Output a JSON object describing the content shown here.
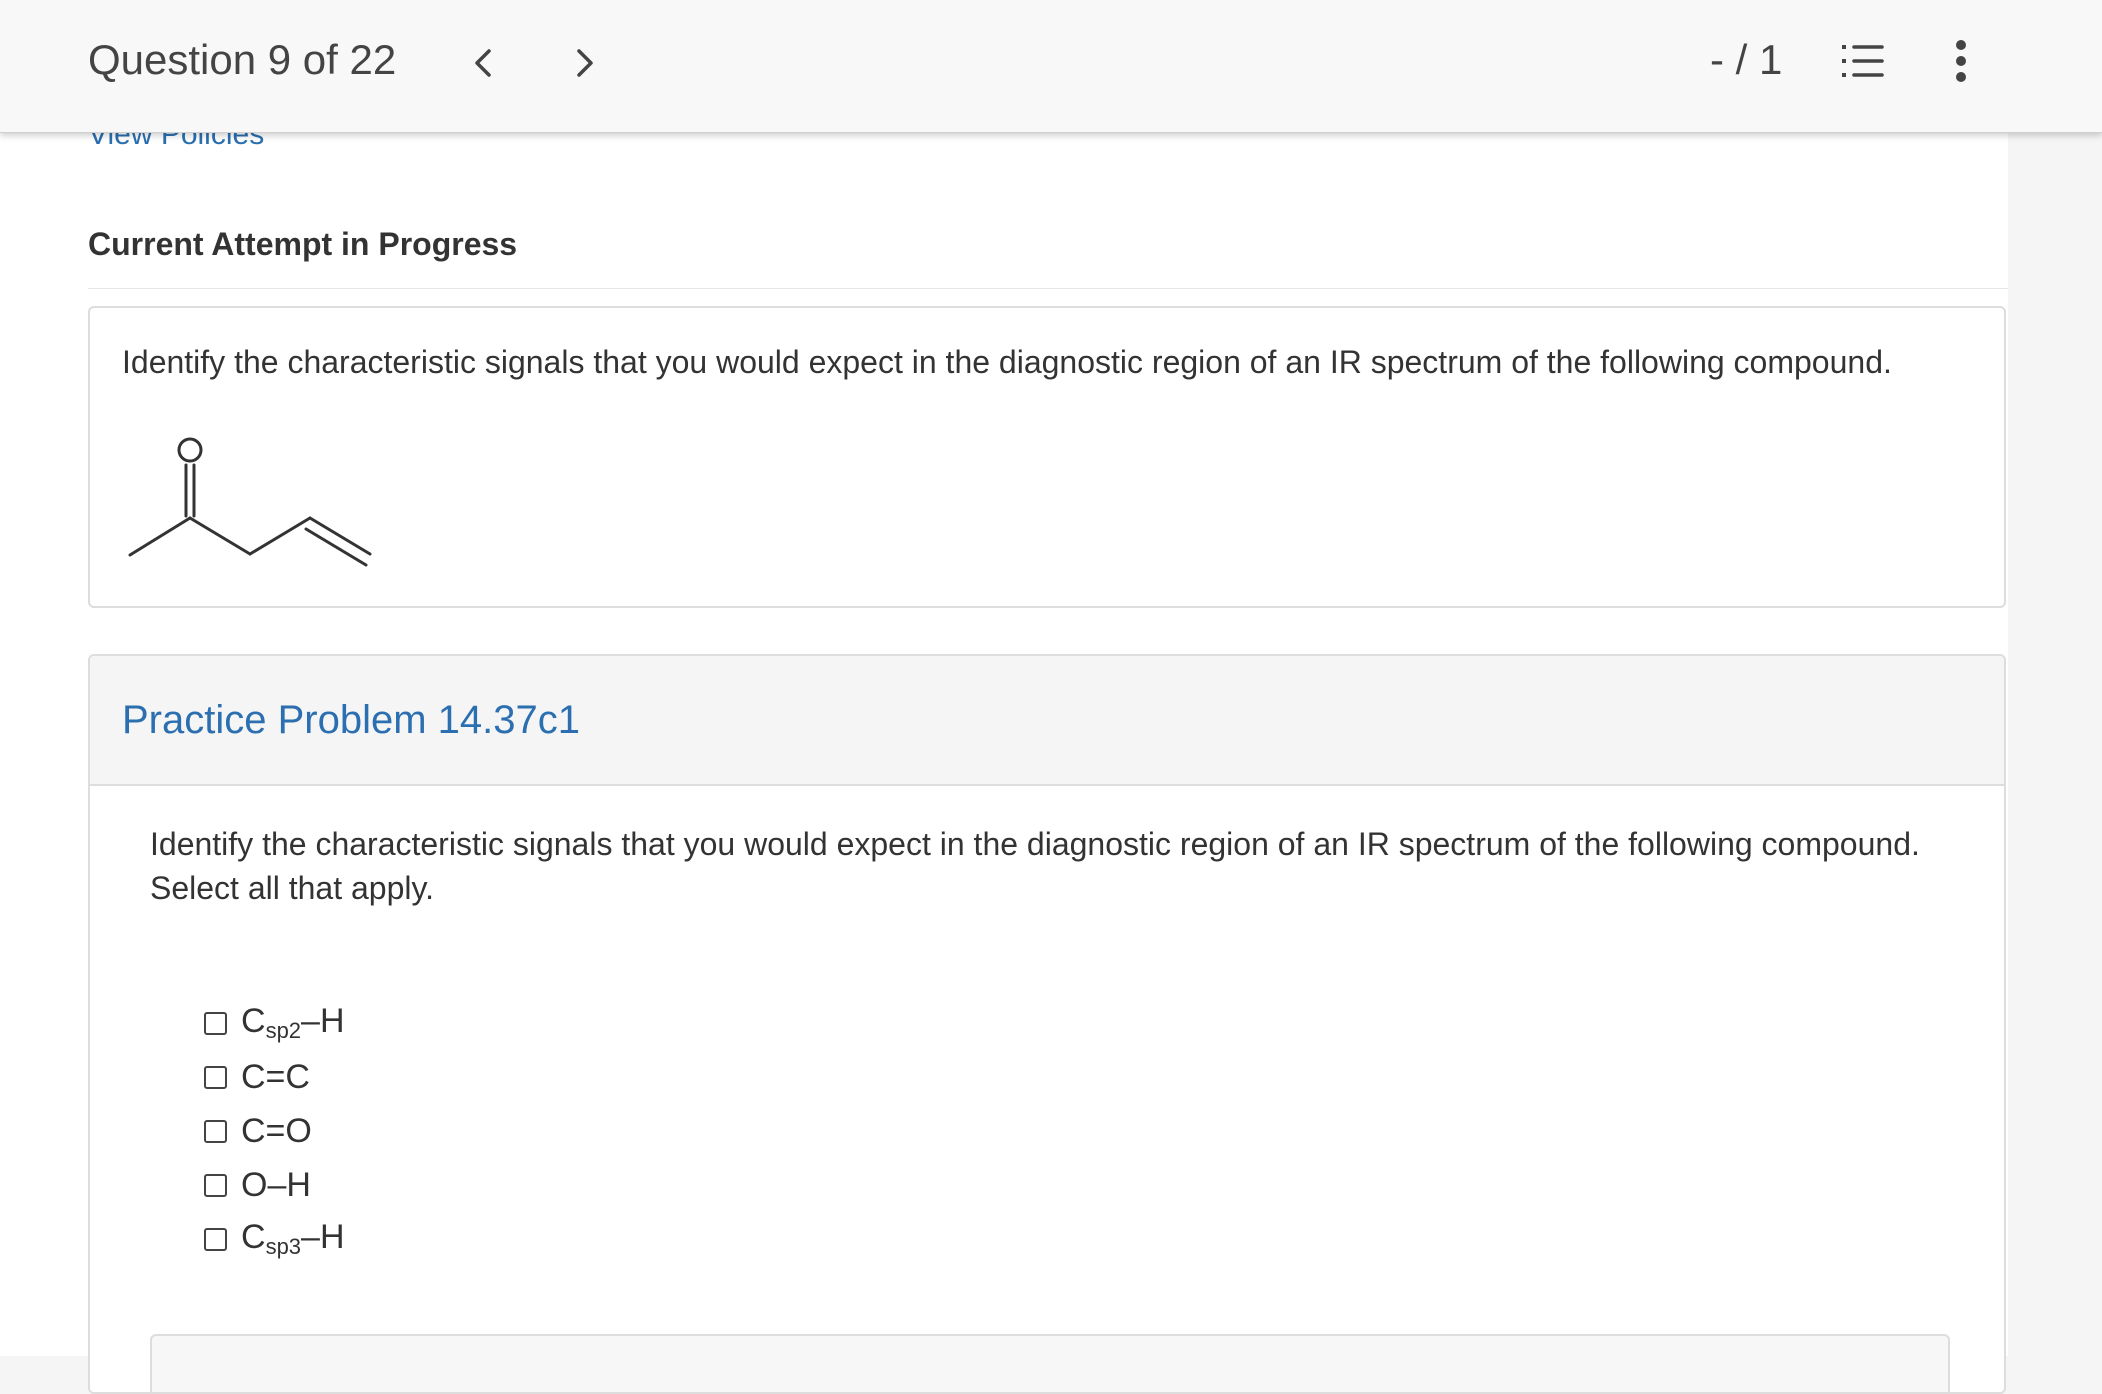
{
  "header": {
    "question_counter": "Question 9 of 22",
    "score": "- / 1",
    "prev_icon": "chevron-left-icon",
    "next_icon": "chevron-right-icon",
    "list_icon": "numbered-list-icon",
    "more_icon": "vertical-dots-icon"
  },
  "page": {
    "view_policies": "View Policies",
    "attempt_title": "Current Attempt in Progress"
  },
  "question": {
    "text": "Identify the characteristic signals that you would expect in the diagnostic region of an IR spectrum of the following compound.",
    "molecule_atom_label": "O"
  },
  "practice": {
    "title": "Practice Problem 14.37c1",
    "prompt_line1": "Identify the characteristic signals that you would expect in the diagnostic region of an IR spectrum of the following compound.",
    "prompt_line2": "Select all that apply.",
    "options": [
      {
        "main": "C",
        "sub": "sp2",
        "suffix": "–H"
      },
      {
        "main": "C=C",
        "sub": "",
        "suffix": ""
      },
      {
        "main": "C=O",
        "sub": "",
        "suffix": ""
      },
      {
        "main": "O–H",
        "sub": "",
        "suffix": ""
      },
      {
        "main": "C",
        "sub": "sp3",
        "suffix": "–H"
      }
    ]
  },
  "colors": {
    "link": "#2b6fb0",
    "header_bg": "#f8f8f8",
    "border": "#dddddd"
  }
}
